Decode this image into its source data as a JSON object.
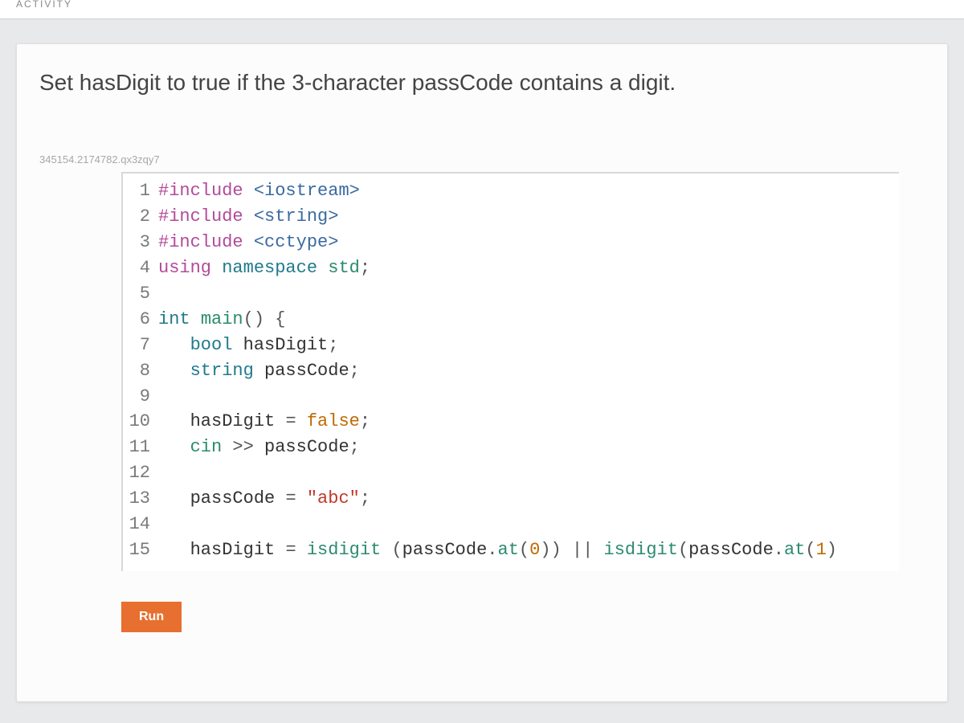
{
  "topbar": {
    "label": "ACTIVITY"
  },
  "instruction": "Set hasDigit to true if the 3-character passCode contains a digit.",
  "vignette_id": "345154.2174782.qx3zqy7",
  "code": {
    "lines": [
      {
        "n": "1",
        "tokens": [
          {
            "t": "#include ",
            "c": "kw-pre"
          },
          {
            "t": "<iostream>",
            "c": "hdr"
          }
        ]
      },
      {
        "n": "2",
        "tokens": [
          {
            "t": "#include ",
            "c": "kw-pre"
          },
          {
            "t": "<string>",
            "c": "hdr"
          }
        ]
      },
      {
        "n": "3",
        "tokens": [
          {
            "t": "#include ",
            "c": "kw-pre"
          },
          {
            "t": "<cctype>",
            "c": "hdr"
          }
        ]
      },
      {
        "n": "4",
        "tokens": [
          {
            "t": "using ",
            "c": "kw-pre"
          },
          {
            "t": "namespace ",
            "c": "kw"
          },
          {
            "t": "std",
            "c": "ns"
          },
          {
            "t": ";",
            "c": "semi"
          }
        ]
      },
      {
        "n": "5",
        "tokens": [
          {
            "t": "",
            "c": "id"
          }
        ]
      },
      {
        "n": "6",
        "tokens": [
          {
            "t": "int ",
            "c": "kw"
          },
          {
            "t": "main",
            "c": "ns"
          },
          {
            "t": "() {",
            "c": "op"
          }
        ]
      },
      {
        "n": "7",
        "tokens": [
          {
            "t": "   ",
            "c": "id"
          },
          {
            "t": "bool ",
            "c": "kw"
          },
          {
            "t": "hasDigit",
            "c": "id"
          },
          {
            "t": ";",
            "c": "semi"
          }
        ]
      },
      {
        "n": "8",
        "tokens": [
          {
            "t": "   ",
            "c": "id"
          },
          {
            "t": "string ",
            "c": "kw"
          },
          {
            "t": "passCode",
            "c": "id"
          },
          {
            "t": ";",
            "c": "semi"
          }
        ]
      },
      {
        "n": "9",
        "tokens": [
          {
            "t": "",
            "c": "id"
          }
        ]
      },
      {
        "n": "10",
        "tokens": [
          {
            "t": "   ",
            "c": "id"
          },
          {
            "t": "hasDigit ",
            "c": "id"
          },
          {
            "t": "= ",
            "c": "op"
          },
          {
            "t": "false",
            "c": "lit"
          },
          {
            "t": ";",
            "c": "semi"
          }
        ]
      },
      {
        "n": "11",
        "tokens": [
          {
            "t": "   ",
            "c": "id"
          },
          {
            "t": "cin ",
            "c": "ns"
          },
          {
            "t": ">> ",
            "c": "op"
          },
          {
            "t": "passCode",
            "c": "id"
          },
          {
            "t": ";",
            "c": "semi"
          }
        ]
      },
      {
        "n": "12",
        "tokens": [
          {
            "t": "",
            "c": "id"
          }
        ]
      },
      {
        "n": "13",
        "tokens": [
          {
            "t": "   ",
            "c": "id"
          },
          {
            "t": "passCode ",
            "c": "id"
          },
          {
            "t": "= ",
            "c": "op"
          },
          {
            "t": "\"abc\"",
            "c": "str"
          },
          {
            "t": ";",
            "c": "semi"
          }
        ]
      },
      {
        "n": "14",
        "tokens": [
          {
            "t": "",
            "c": "id"
          }
        ]
      },
      {
        "n": "15",
        "tokens": [
          {
            "t": "   ",
            "c": "id"
          },
          {
            "t": "hasDigit ",
            "c": "id"
          },
          {
            "t": "= ",
            "c": "op"
          },
          {
            "t": "isdigit ",
            "c": "fn"
          },
          {
            "t": "(",
            "c": "op"
          },
          {
            "t": "passCode",
            "c": "id"
          },
          {
            "t": ".",
            "c": "op"
          },
          {
            "t": "at",
            "c": "fn"
          },
          {
            "t": "(",
            "c": "op"
          },
          {
            "t": "0",
            "c": "lit"
          },
          {
            "t": ")) ",
            "c": "op"
          },
          {
            "t": "|| ",
            "c": "op"
          },
          {
            "t": "isdigit",
            "c": "fn"
          },
          {
            "t": "(",
            "c": "op"
          },
          {
            "t": "passCode",
            "c": "id"
          },
          {
            "t": ".",
            "c": "op"
          },
          {
            "t": "at",
            "c": "fn"
          },
          {
            "t": "(",
            "c": "op"
          },
          {
            "t": "1",
            "c": "lit"
          },
          {
            "t": ")",
            "c": "op"
          }
        ]
      }
    ]
  },
  "buttons": {
    "run": "Run"
  }
}
